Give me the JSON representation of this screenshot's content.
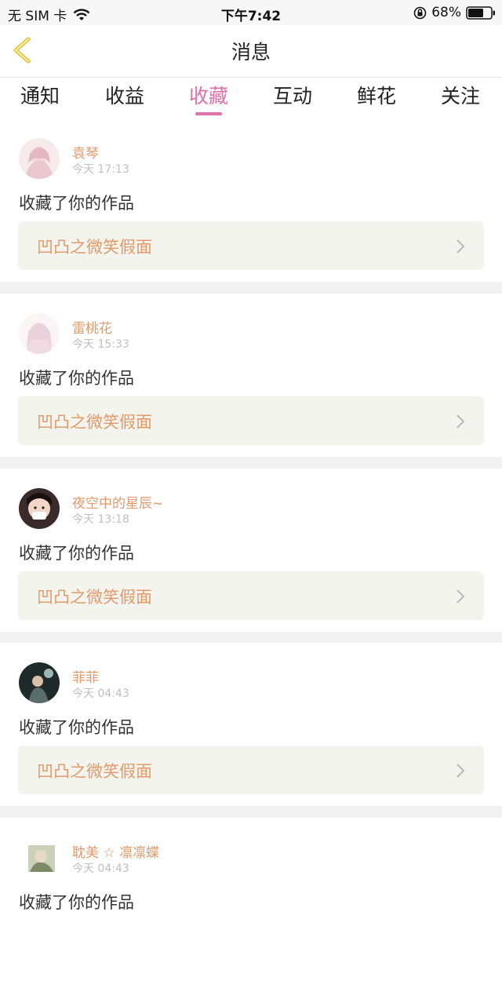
{
  "status_bar": {
    "carrier": "无 SIM 卡",
    "time": "下午7:42",
    "battery": "68%",
    "battery_level": 0.68,
    "icons": [
      "wifi-icon",
      "lock-rotation-icon",
      "battery-icon"
    ]
  },
  "nav": {
    "title": "消息",
    "back_icon": "chevron-left-icon"
  },
  "tabs": [
    {
      "label": "通知"
    },
    {
      "label": "收益"
    },
    {
      "label": "收藏",
      "active": true
    },
    {
      "label": "互动"
    },
    {
      "label": "鲜花"
    },
    {
      "label": "关注"
    }
  ],
  "items": [
    {
      "user": "袁琴",
      "time": "今天 17:13",
      "action": "收藏了你的作品",
      "work": "凹凸之微笑假面"
    },
    {
      "user": "雷桃花",
      "time": "今天 15:33",
      "action": "收藏了你的作品",
      "work": "凹凸之微笑假面"
    },
    {
      "user": "夜空中的星辰~",
      "time": "今天 13:18",
      "action": "收藏了你的作品",
      "work": "凹凸之微笑假面"
    },
    {
      "user": "菲菲",
      "time": "今天 04:43",
      "action": "收藏了你的作品",
      "work": "凹凸之微笑假面"
    },
    {
      "user": "耽美 ☆ 凛凛蝶",
      "time": "今天 04:43",
      "action": "收藏了你的作品",
      "work": ""
    }
  ],
  "colors": {
    "accent": "#e36fa9",
    "username": "#e39a6a",
    "back_arrow": "#e8c13a",
    "card_link_bg": "#f4f4ee"
  }
}
